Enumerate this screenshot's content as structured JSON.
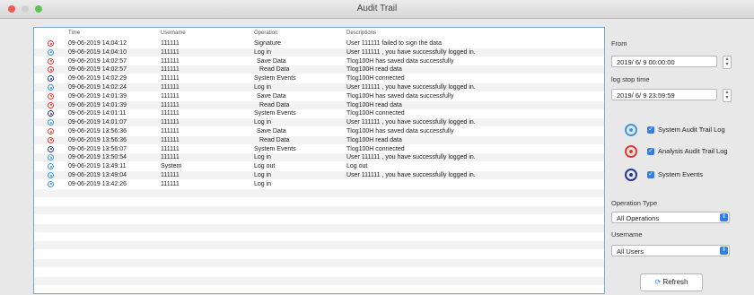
{
  "window": {
    "title": "Audit Trail"
  },
  "colors": {
    "signature": "#e53935",
    "login": "#3a9ad9",
    "system": "#283593",
    "accent": "#2f7ee6"
  },
  "table": {
    "headers": {
      "time": "Time",
      "username": "Username",
      "operation": "Operation",
      "descriptions": "Descriptions"
    },
    "rows": [
      {
        "icon": "signature",
        "time": "09-06-2019 14:04:12",
        "username": "111111",
        "operation": "Signature",
        "description": "User 111111 failed to sign the data"
      },
      {
        "icon": "login",
        "time": "09-06-2019 14:04:10",
        "username": "111111",
        "operation": "Log in",
        "description": "User 111111 , you have successfully logged in."
      },
      {
        "icon": "signature",
        "time": "09-06-2019 14:02:57",
        "username": "111111",
        "operation": "Save Data",
        "description": "Tlog100H has saved data successfully"
      },
      {
        "icon": "signature",
        "time": "09-06-2019 14:02:57",
        "username": "111111",
        "operation": "Read Data",
        "description": "Tlog100H read data"
      },
      {
        "icon": "system",
        "time": "09-06-2019 14:02:29",
        "username": "111111",
        "operation": "System Events",
        "description": "Tlog100H connected"
      },
      {
        "icon": "login",
        "time": "09-06-2019 14:02:24",
        "username": "111111",
        "operation": "Log in",
        "description": "User 111111 , you have successfully logged in."
      },
      {
        "icon": "signature",
        "time": "09-06-2019 14:01:39",
        "username": "111111",
        "operation": "Save Data",
        "description": "Tlog100H has saved data successfully"
      },
      {
        "icon": "signature",
        "time": "09-06-2019 14:01:39",
        "username": "111111",
        "operation": "Read Data",
        "description": "Tlog100H read data"
      },
      {
        "icon": "system",
        "time": "09-06-2019 14:01:11",
        "username": "111111",
        "operation": "System Events",
        "description": "Tlog100H connected"
      },
      {
        "icon": "login",
        "time": "09-06-2019 14:01:07",
        "username": "111111",
        "operation": "Log in",
        "description": "User 111111 , you have successfully logged in."
      },
      {
        "icon": "signature",
        "time": "09-06-2019 13:56:36",
        "username": "111111",
        "operation": "Save Data",
        "description": "Tlog100H has saved data successfully"
      },
      {
        "icon": "signature",
        "time": "09-06-2019 13:56:36",
        "username": "111111",
        "operation": "Read Data",
        "description": "Tlog100H read data"
      },
      {
        "icon": "system",
        "time": "09-06-2019 13:56:07",
        "username": "111111",
        "operation": "System Events",
        "description": "Tlog100H connected"
      },
      {
        "icon": "login",
        "time": "09-06-2019 13:50:54",
        "username": "111111",
        "operation": "Log in",
        "description": "User 111111 , you have successfully logged in."
      },
      {
        "icon": "login",
        "time": "09-06-2019 13:49:11",
        "username": "System",
        "operation": "Log out",
        "description": "Log out"
      },
      {
        "icon": "login",
        "time": "09-06-2019 13:49:04",
        "username": "111111",
        "operation": "Log in",
        "description": "User 111111 , you have successfully logged in."
      },
      {
        "icon": "login",
        "time": "09-06-2019 13:42:26",
        "username": "111111",
        "operation": "Log in",
        "description": ""
      }
    ]
  },
  "side": {
    "from_label": "From",
    "from_value": "2019/ 6/ 9 00:00:00",
    "stop_label": "log stop time",
    "stop_value": "2019/ 6/ 9 23:59:59",
    "legend": [
      {
        "icon": "login",
        "label": "System Audit Trail Log"
      },
      {
        "icon": "signature",
        "label": "Analysis Audit Trail Log"
      },
      {
        "icon": "system",
        "label": "System Events"
      }
    ],
    "operation_type_label": "Operation Type",
    "operation_type_value": "All Operations",
    "username_label": "Username",
    "username_value": "All Users",
    "refresh_label": "Refresh"
  }
}
